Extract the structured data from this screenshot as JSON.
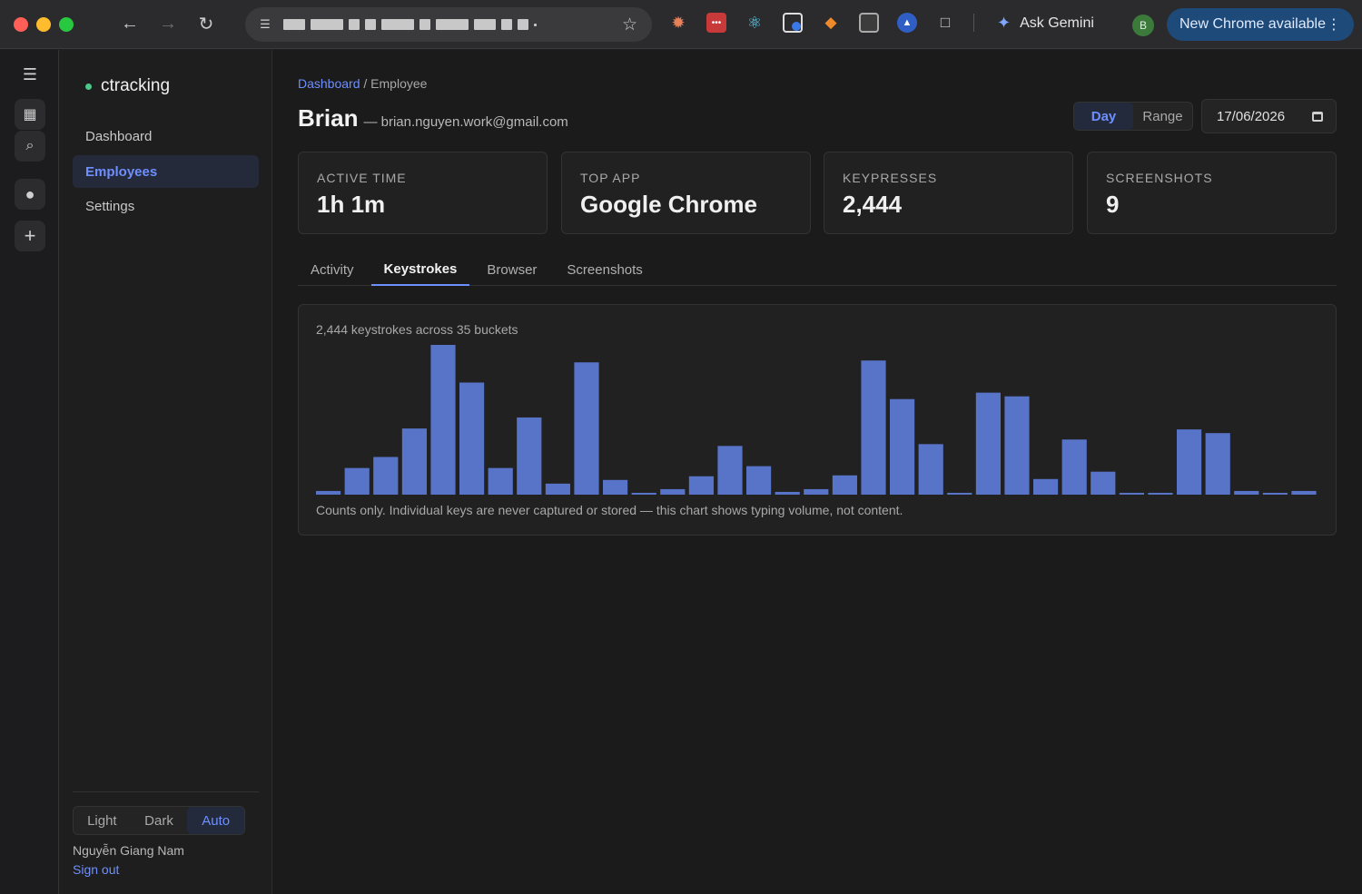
{
  "browser": {
    "new_chrome_label": "New Chrome available",
    "gemini_label": "Ask Gemini",
    "profile_initial": "B"
  },
  "app": {
    "brand": "ctracking",
    "nav": [
      {
        "label": "Dashboard",
        "active": false
      },
      {
        "label": "Employees",
        "active": true
      },
      {
        "label": "Settings",
        "active": false
      }
    ],
    "theme": {
      "options": [
        "Light",
        "Dark",
        "Auto"
      ],
      "selected": "Auto"
    },
    "user_name": "Nguyễn Giang Nam",
    "signout_label": "Sign out"
  },
  "page": {
    "breadcrumb_root": "Dashboard",
    "breadcrumb_sep": " / ",
    "breadcrumb_current": "Employee",
    "employee_name": "Brian",
    "employee_email": "— brian.nguyen.work@gmail.com",
    "mode_options": [
      "Day",
      "Range"
    ],
    "mode_selected": "Day",
    "date_value": "17/06/2026",
    "stats": [
      {
        "label": "Active time",
        "value": "1h 1m"
      },
      {
        "label": "Top app",
        "value": "Google Chrome"
      },
      {
        "label": "Keypresses",
        "value": "2,444"
      },
      {
        "label": "Screenshots",
        "value": "9"
      }
    ],
    "tabs": [
      "Activity",
      "Keystrokes",
      "Browser",
      "Screenshots"
    ],
    "active_tab": "Keystrokes",
    "chart_caption": "2,444 keystrokes across 35 buckets",
    "chart_note": "Counts only. Individual keys are never captured or stored — this chart shows typing volume, not content."
  },
  "colors": {
    "accent": "#6e8fff",
    "bar": "#5874c9",
    "brand_dot": "#4cc98a"
  },
  "chart_data": {
    "type": "bar",
    "title": "2,444 keystrokes across 35 buckets",
    "xlabel": "",
    "ylabel": "",
    "categories": [],
    "values": [
      4,
      29,
      41,
      72,
      163,
      122,
      29,
      84,
      12,
      144,
      16,
      2,
      6,
      20,
      53,
      31,
      3,
      6,
      21,
      146,
      104,
      55,
      2,
      111,
      107,
      17,
      60,
      25,
      2,
      2,
      71,
      67,
      4,
      2,
      4
    ],
    "ylim": [
      0,
      163
    ],
    "grid": false,
    "legend": "none"
  }
}
